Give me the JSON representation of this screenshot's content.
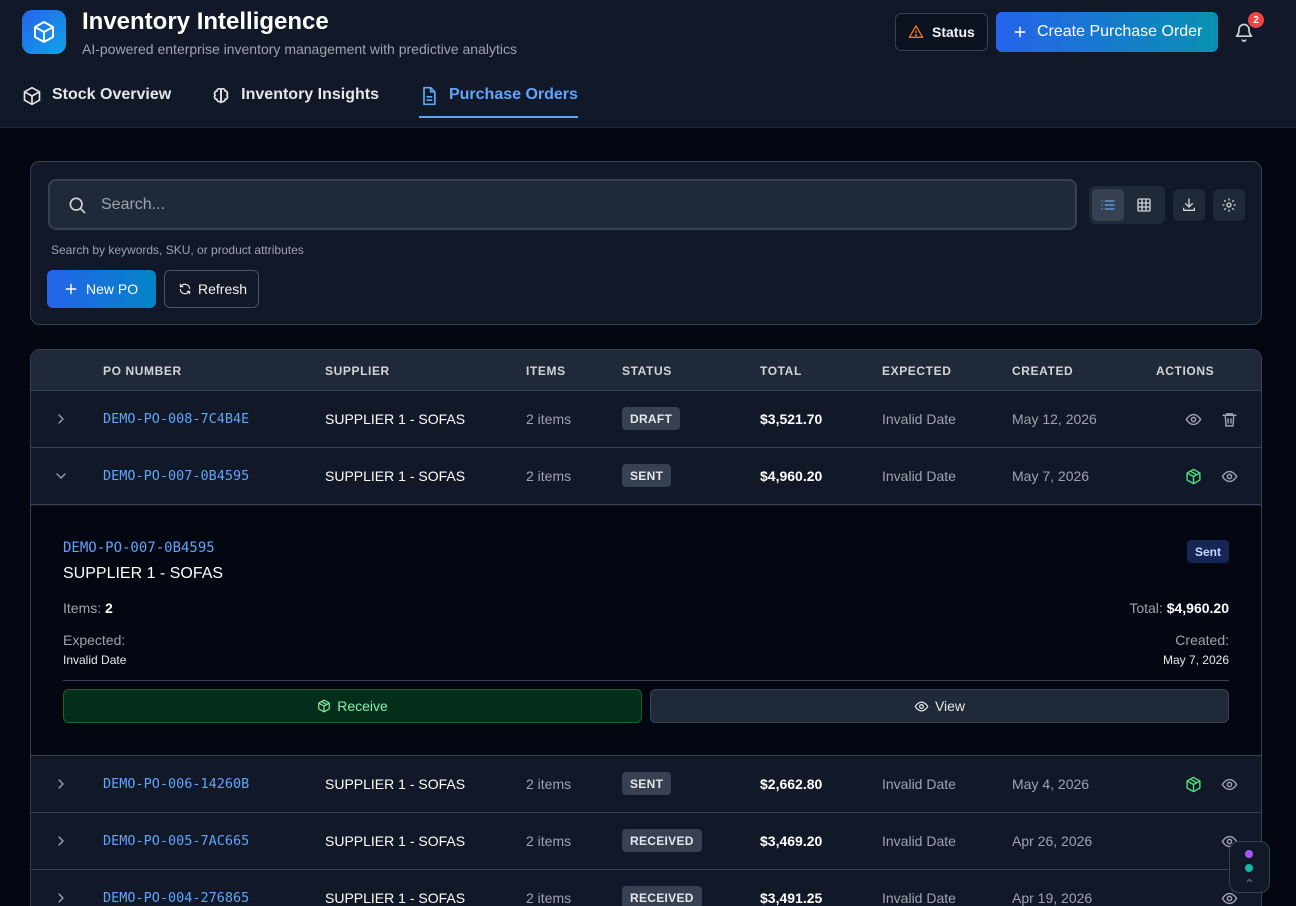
{
  "app": {
    "title": "Inventory Intelligence",
    "subtitle": "AI-powered enterprise inventory management with predictive analytics",
    "logo_icon": "package-icon"
  },
  "header": {
    "status_label": "Status",
    "create_po_label": "Create Purchase Order",
    "notification_count": "2"
  },
  "tabs": [
    {
      "label": "Stock Overview",
      "icon": "package-icon",
      "active": false
    },
    {
      "label": "Inventory Insights",
      "icon": "brain-icon",
      "active": false
    },
    {
      "label": "Purchase Orders",
      "icon": "document-icon",
      "active": true
    }
  ],
  "search": {
    "placeholder": "Search...",
    "value": "",
    "hint": "Search by keywords, SKU, or product attributes",
    "view_mode": "list"
  },
  "toolbar": {
    "new_po_label": "New PO",
    "refresh_label": "Refresh"
  },
  "table": {
    "columns": [
      "PO NUMBER",
      "SUPPLIER",
      "ITEMS",
      "STATUS",
      "TOTAL",
      "EXPECTED",
      "CREATED",
      "ACTIONS"
    ],
    "rows": [
      {
        "po": "DEMO-PO-008-7C4B4E",
        "supplier": "SUPPLIER 1 - SOFAS",
        "items": "2 items",
        "status": "DRAFT",
        "total": "$3,521.70",
        "expected": "Invalid Date",
        "created": "May 12, 2026"
      },
      {
        "po": "DEMO-PO-007-0B4595",
        "supplier": "SUPPLIER 1 - SOFAS",
        "items": "2 items",
        "status": "SENT",
        "total": "$4,960.20",
        "expected": "Invalid Date",
        "created": "May 7, 2026"
      },
      {
        "po": "DEMO-PO-006-14260B",
        "supplier": "SUPPLIER 1 - SOFAS",
        "items": "2 items",
        "status": "SENT",
        "total": "$2,662.80",
        "expected": "Invalid Date",
        "created": "May 4, 2026"
      },
      {
        "po": "DEMO-PO-005-7AC665",
        "supplier": "SUPPLIER 1 - SOFAS",
        "items": "2 items",
        "status": "RECEIVED",
        "total": "$3,469.20",
        "expected": "Invalid Date",
        "created": "Apr 26, 2026"
      },
      {
        "po": "DEMO-PO-004-276865",
        "supplier": "SUPPLIER 1 - SOFAS",
        "items": "2 items",
        "status": "RECEIVED",
        "total": "$3,491.25",
        "expected": "Invalid Date",
        "created": "Apr 19, 2026"
      }
    ]
  },
  "detail": {
    "po": "DEMO-PO-007-0B4595",
    "supplier": "SUPPLIER 1 - SOFAS",
    "status": "Sent",
    "items_label": "Items:",
    "items_value": "2",
    "total_label": "Total:",
    "total_value": "$4,960.20",
    "expected_label": "Expected:",
    "expected_value": "Invalid Date",
    "created_label": "Created:",
    "created_value": "May 7, 2026",
    "receive_label": "Receive",
    "view_label": "View"
  },
  "colors": {
    "accent": "#60a5fa",
    "brand_gradient_start": "#2563eb",
    "brand_gradient_end": "#0891b2",
    "receive_green": "#4ade80",
    "warning": "#f97316",
    "danger": "#ef4444"
  }
}
